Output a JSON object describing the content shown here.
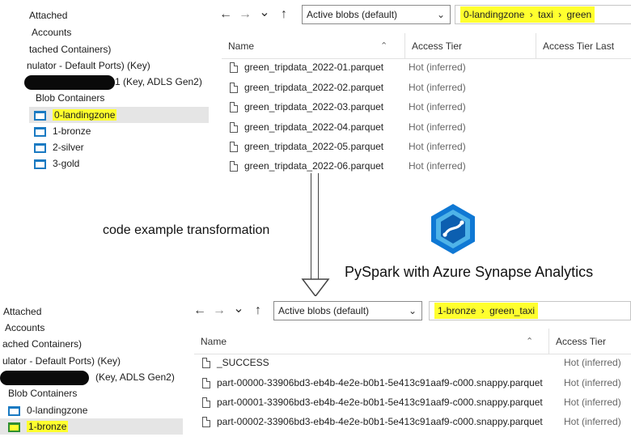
{
  "top": {
    "tree": [
      {
        "label": "Attached",
        "cls": ""
      },
      {
        "label": "Accounts",
        "cls": ""
      },
      {
        "label": "tached Containers)",
        "cls": ""
      },
      {
        "label": "nulator - Default Ports) (Key)",
        "cls": ""
      },
      {
        "label": "1 (Key, ADLS Gen2)",
        "cls": "redacted"
      },
      {
        "label": "Blob Containers",
        "cls": ""
      },
      {
        "label": "0-landingzone",
        "cls": "selected"
      },
      {
        "label": "1-bronze",
        "cls": ""
      },
      {
        "label": "2-silver",
        "cls": ""
      },
      {
        "label": "3-gold",
        "cls": ""
      }
    ],
    "select": "Active blobs (default)",
    "breadcrumb": [
      "0-landingzone",
      "taxi",
      "green"
    ],
    "columns": {
      "name": "Name",
      "tier": "Access Tier",
      "tier2": "Access Tier Last"
    },
    "files": [
      {
        "name": "green_tripdata_2022-01.parquet",
        "tier": "Hot (inferred)"
      },
      {
        "name": "green_tripdata_2022-02.parquet",
        "tier": "Hot (inferred)"
      },
      {
        "name": "green_tripdata_2022-03.parquet",
        "tier": "Hot (inferred)"
      },
      {
        "name": "green_tripdata_2022-04.parquet",
        "tier": "Hot (inferred)"
      },
      {
        "name": "green_tripdata_2022-05.parquet",
        "tier": "Hot (inferred)"
      },
      {
        "name": "green_tripdata_2022-06.parquet",
        "tier": "Hot (inferred)"
      }
    ]
  },
  "middle": {
    "caption": "code example transformation",
    "product": "PySpark with Azure Synapse Analytics"
  },
  "bottom": {
    "tree": [
      {
        "label": "Attached",
        "cls": ""
      },
      {
        "label": "Accounts",
        "cls": ""
      },
      {
        "label": "ached Containers)",
        "cls": ""
      },
      {
        "label": "ulator - Default Ports) (Key)",
        "cls": ""
      },
      {
        "label": "(Key, ADLS Gen2)",
        "cls": "redacted"
      },
      {
        "label": "Blob Containers",
        "cls": ""
      },
      {
        "label": "0-landingzone",
        "cls": ""
      },
      {
        "label": "1-bronze",
        "cls": "selected"
      }
    ],
    "select": "Active blobs (default)",
    "breadcrumb": [
      "1-bronze",
      "green_taxi"
    ],
    "columns": {
      "name": "Name",
      "tier": "Access Tier"
    },
    "files": [
      {
        "name": "_SUCCESS",
        "tier": "Hot (inferred)"
      },
      {
        "name": "part-00000-33906bd3-eb4b-4e2e-b0b1-5e413c91aaf9-c000.snappy.parquet",
        "tier": "Hot (inferred)"
      },
      {
        "name": "part-00001-33906bd3-eb4b-4e2e-b0b1-5e413c91aaf9-c000.snappy.parquet",
        "tier": "Hot (inferred)"
      },
      {
        "name": "part-00002-33906bd3-eb4b-4e2e-b0b1-5e413c91aaf9-c000.snappy.parquet",
        "tier": "Hot (inferred)"
      }
    ]
  },
  "icons": {
    "back": "←",
    "forward": "→",
    "recent": "⌄",
    "up": "↑",
    "dropdown": "⌄",
    "crumb_sep": "›",
    "sort_up": "⌃"
  },
  "colors": {
    "highlight": "#ffff2e",
    "container_blue": "#1a7ac2",
    "synapse_blue": "#0f78d4"
  }
}
